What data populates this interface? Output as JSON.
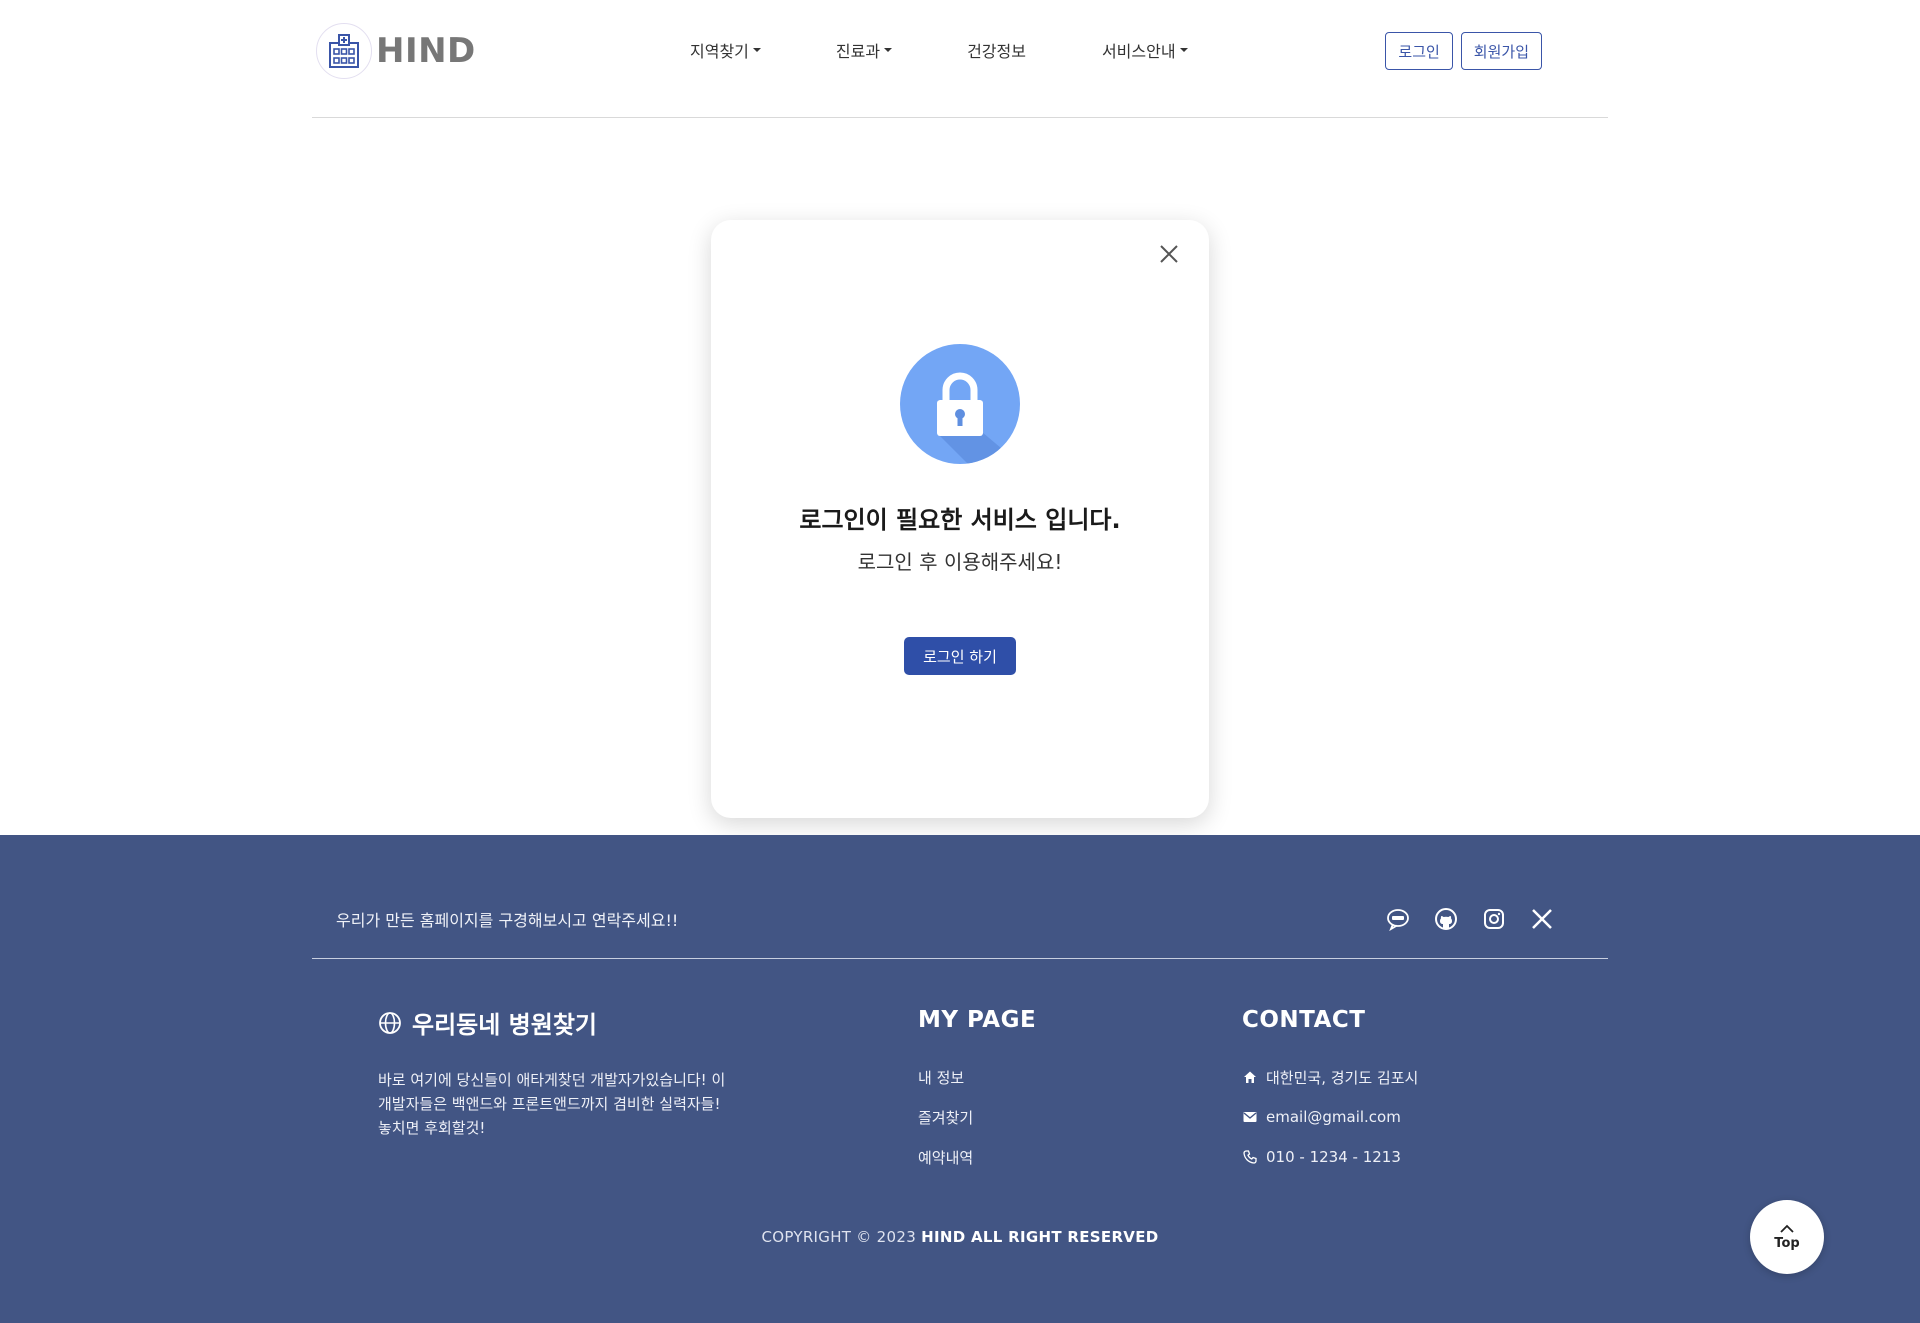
{
  "header": {
    "logo_text": "HIND",
    "nav": [
      {
        "label": "지역찾기",
        "dropdown": true
      },
      {
        "label": "진료과",
        "dropdown": true
      },
      {
        "label": "건강정보",
        "dropdown": false
      },
      {
        "label": "서비스안내",
        "dropdown": true
      }
    ],
    "login_label": "로그인",
    "signup_label": "회원가입"
  },
  "modal": {
    "title": "로그인이 필요한 서비스 입니다.",
    "subtitle": "로그인 후 이용해주세요!",
    "button_label": "로그인 하기"
  },
  "footer": {
    "tagline": "우리가 만든 홈페이지를 구경해보시고 연락주세요!!",
    "socials": [
      "kakaotalk-icon",
      "github-icon",
      "instagram-icon",
      "x-icon"
    ],
    "brand_title": "우리동네 병원찾기",
    "brand_desc": [
      "바로 여기에 당신들이 애타게찾던 개발자가있습니다! 이",
      "개발자들은 백앤드와 프론트앤드까지 겸비한 실력자들!",
      "놓치면 후회할것!"
    ],
    "mypage": {
      "title": "MY PAGE",
      "items": [
        "내 정보",
        "즐겨찾기",
        "예약내역"
      ]
    },
    "contact": {
      "title": "CONTACT",
      "address": "대한민국, 경기도 김포시",
      "email": "email@gmail.com",
      "phone": "010 - 1234 - 1213"
    },
    "copyright_prefix": "COPYRIGHT © 2023",
    "copyright_strong": "HIND ALL RIGHT RESERVED"
  },
  "top_button": {
    "label": "Top"
  },
  "colors": {
    "brand": "#3a55a8",
    "primary_button": "#2f4fa8",
    "footer_bg": "#425584",
    "lock_circle": "#73a6f5"
  }
}
